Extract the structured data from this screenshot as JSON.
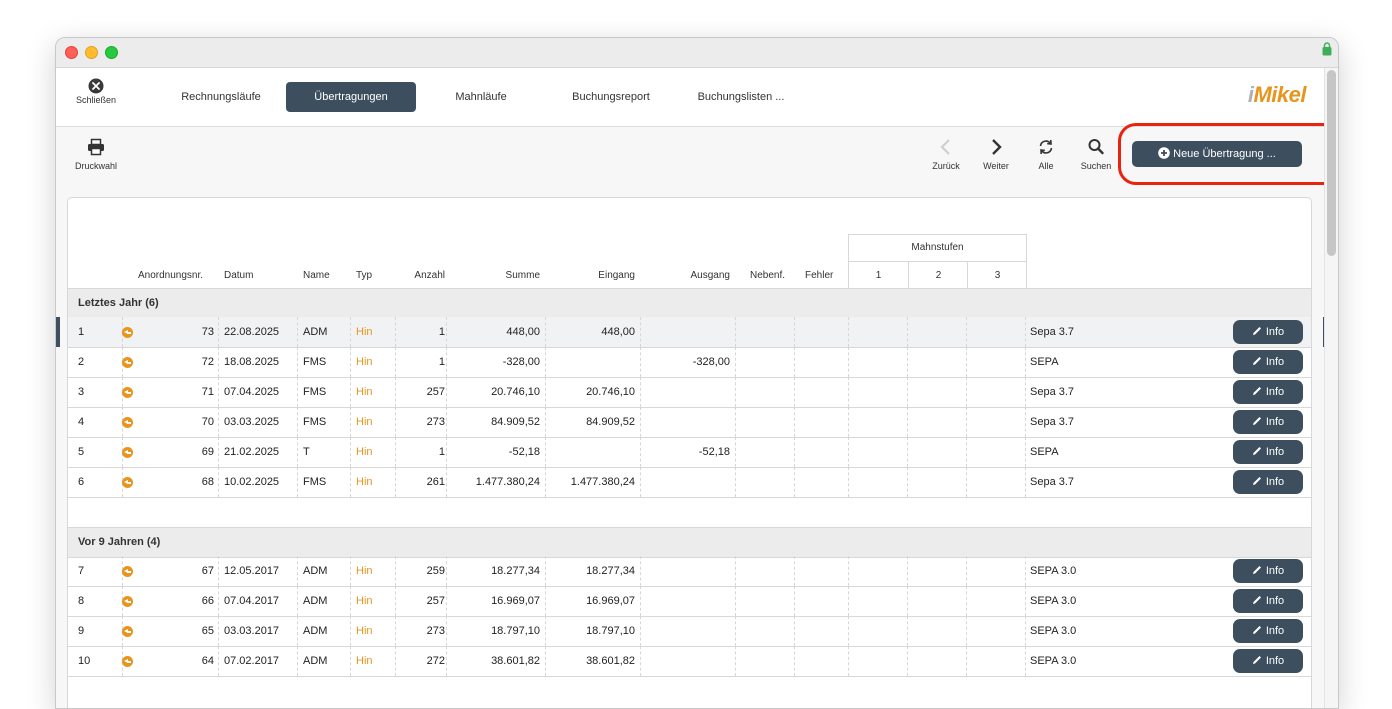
{
  "window": {
    "title": ""
  },
  "nav": {
    "close_label": "Schließen",
    "tabs": [
      {
        "label": "Rechnungsläufe",
        "active": false
      },
      {
        "label": "Übertragungen",
        "active": true
      },
      {
        "label": "Mahnläufe",
        "active": false
      },
      {
        "label": "Buchungsreport",
        "active": false
      },
      {
        "label": "Buchungslisten ...",
        "active": false
      }
    ],
    "logo_prefix": "i",
    "logo_text": "Mikel"
  },
  "toolbar": {
    "print_label": "Druckwahl",
    "back_label": "Zurück",
    "next_label": "Weiter",
    "all_label": "Alle",
    "search_label": "Suchen",
    "new_label": "Neue Übertragung ..."
  },
  "table": {
    "headers": {
      "nr": "Anordnungsnr.",
      "datum": "Datum",
      "name": "Name",
      "typ": "Typ",
      "anzahl": "Anzahl",
      "summe": "Summe",
      "eingang": "Eingang",
      "ausgang": "Ausgang",
      "nebenf": "Nebenf.",
      "fehler": "Fehler",
      "mahnstufen": "Mahnstufen",
      "m1": "1",
      "m2": "2",
      "m3": "3"
    },
    "info_label": "Info",
    "groups": [
      {
        "title": "Letztes Jahr (6)",
        "rows": [
          {
            "idx": "1",
            "nr": "73",
            "datum": "22.08.2025",
            "name": "ADM",
            "typ": "Hin",
            "anzahl": "1",
            "summe": "448,00",
            "eingang": "448,00",
            "ausgang": "",
            "format": "Sepa 3.7",
            "selected": true
          },
          {
            "idx": "2",
            "nr": "72",
            "datum": "18.08.2025",
            "name": "FMS",
            "typ": "Hin",
            "anzahl": "1",
            "summe": "-328,00",
            "eingang": "",
            "ausgang": "-328,00",
            "format": "SEPA",
            "selected": false
          },
          {
            "idx": "3",
            "nr": "71",
            "datum": "07.04.2025",
            "name": "FMS",
            "typ": "Hin",
            "anzahl": "257",
            "summe": "20.746,10",
            "eingang": "20.746,10",
            "ausgang": "",
            "format": "Sepa 3.7",
            "selected": false
          },
          {
            "idx": "4",
            "nr": "70",
            "datum": "03.03.2025",
            "name": "FMS",
            "typ": "Hin",
            "anzahl": "273",
            "summe": "84.909,52",
            "eingang": "84.909,52",
            "ausgang": "",
            "format": "Sepa 3.7",
            "selected": false
          },
          {
            "idx": "5",
            "nr": "69",
            "datum": "21.02.2025",
            "name": "T",
            "typ": "Hin",
            "anzahl": "1",
            "summe": "-52,18",
            "eingang": "",
            "ausgang": "-52,18",
            "format": "SEPA",
            "selected": false
          },
          {
            "idx": "6",
            "nr": "68",
            "datum": "10.02.2025",
            "name": "FMS",
            "typ": "Hin",
            "anzahl": "261",
            "summe": "1.477.380,24",
            "eingang": "1.477.380,24",
            "ausgang": "",
            "format": "Sepa 3.7",
            "selected": false
          }
        ]
      },
      {
        "title": "Vor 9 Jahren (4)",
        "rows": [
          {
            "idx": "7",
            "nr": "67",
            "datum": "12.05.2017",
            "name": "ADM",
            "typ": "Hin",
            "anzahl": "259",
            "summe": "18.277,34",
            "eingang": "18.277,34",
            "ausgang": "",
            "format": "SEPA 3.0",
            "selected": false
          },
          {
            "idx": "8",
            "nr": "66",
            "datum": "07.04.2017",
            "name": "ADM",
            "typ": "Hin",
            "anzahl": "257",
            "summe": "16.969,07",
            "eingang": "16.969,07",
            "ausgang": "",
            "format": "SEPA 3.0",
            "selected": false
          },
          {
            "idx": "9",
            "nr": "65",
            "datum": "03.03.2017",
            "name": "ADM",
            "typ": "Hin",
            "anzahl": "273",
            "summe": "18.797,10",
            "eingang": "18.797,10",
            "ausgang": "",
            "format": "SEPA 3.0",
            "selected": false
          },
          {
            "idx": "10",
            "nr": "64",
            "datum": "07.02.2017",
            "name": "ADM",
            "typ": "Hin",
            "anzahl": "272",
            "summe": "38.601,82",
            "eingang": "38.601,82",
            "ausgang": "",
            "format": "SEPA 3.0",
            "selected": false
          }
        ]
      }
    ]
  }
}
